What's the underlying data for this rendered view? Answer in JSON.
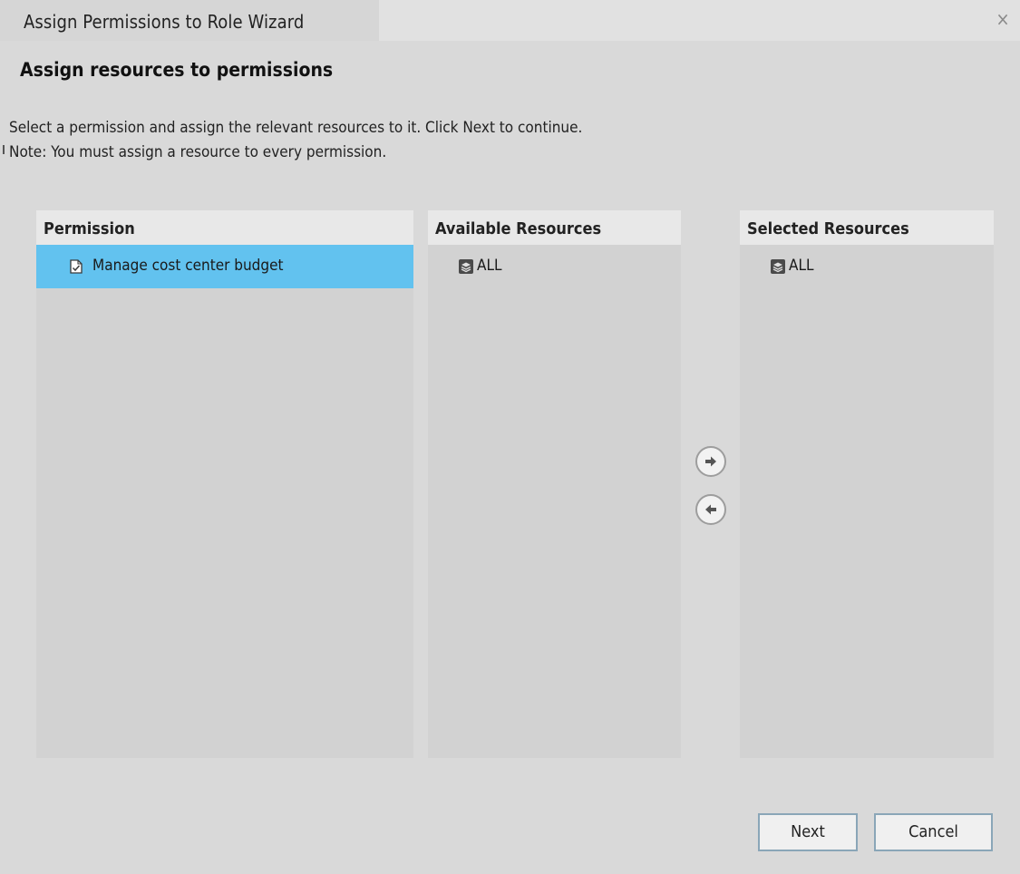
{
  "window": {
    "title": "Assign Permissions to Role Wizard",
    "close_symbol": "×"
  },
  "step": {
    "heading": "Assign resources to permissions",
    "instruction_line1": "Select a permission and assign the relevant resources to it. Click Next to continue.",
    "instruction_line2": "Note: You must assign a resource to every permission."
  },
  "permission_panel": {
    "header": "Permission",
    "items": [
      {
        "label": "Manage cost center budget",
        "icon": "checked-document-icon",
        "selected": true
      }
    ]
  },
  "available_panel": {
    "header": "Available Resources",
    "items": [
      {
        "label": "ALL",
        "icon": "resource-stack-icon"
      }
    ]
  },
  "selected_panel": {
    "header": "Selected Resources",
    "items": [
      {
        "label": "ALL",
        "icon": "resource-stack-icon"
      }
    ]
  },
  "transfer": {
    "add_icon": "arrow-right-icon",
    "remove_icon": "arrow-left-icon"
  },
  "footer": {
    "next_label": "Next",
    "cancel_label": "Cancel"
  },
  "colors": {
    "selection": "#62c2ef",
    "panel_bg": "#d2d2d2",
    "header_bg": "#e8e8e8",
    "button_border": "#8aa6b8"
  }
}
